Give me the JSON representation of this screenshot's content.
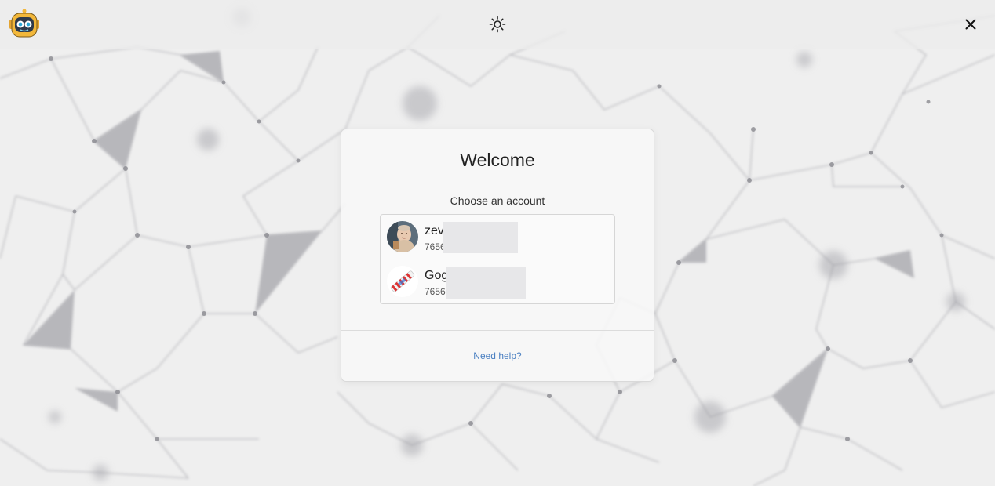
{
  "window": {
    "logo_icon": "robot-logo-icon",
    "theme_toggle_icon": "sun-icon",
    "close_icon": "close-icon"
  },
  "login": {
    "title": "Welcome",
    "subtitle": "Choose an account",
    "help_link": "Need help?",
    "accounts": [
      {
        "name": "zev",
        "id": "7656",
        "avatar_icon": "baby-photo-avatar"
      },
      {
        "name": "Gog",
        "id": "7656",
        "avatar_icon": "candy-cane-avatar"
      }
    ]
  },
  "colors": {
    "accent_link": "#4a7fc1",
    "background": "#ededed"
  }
}
